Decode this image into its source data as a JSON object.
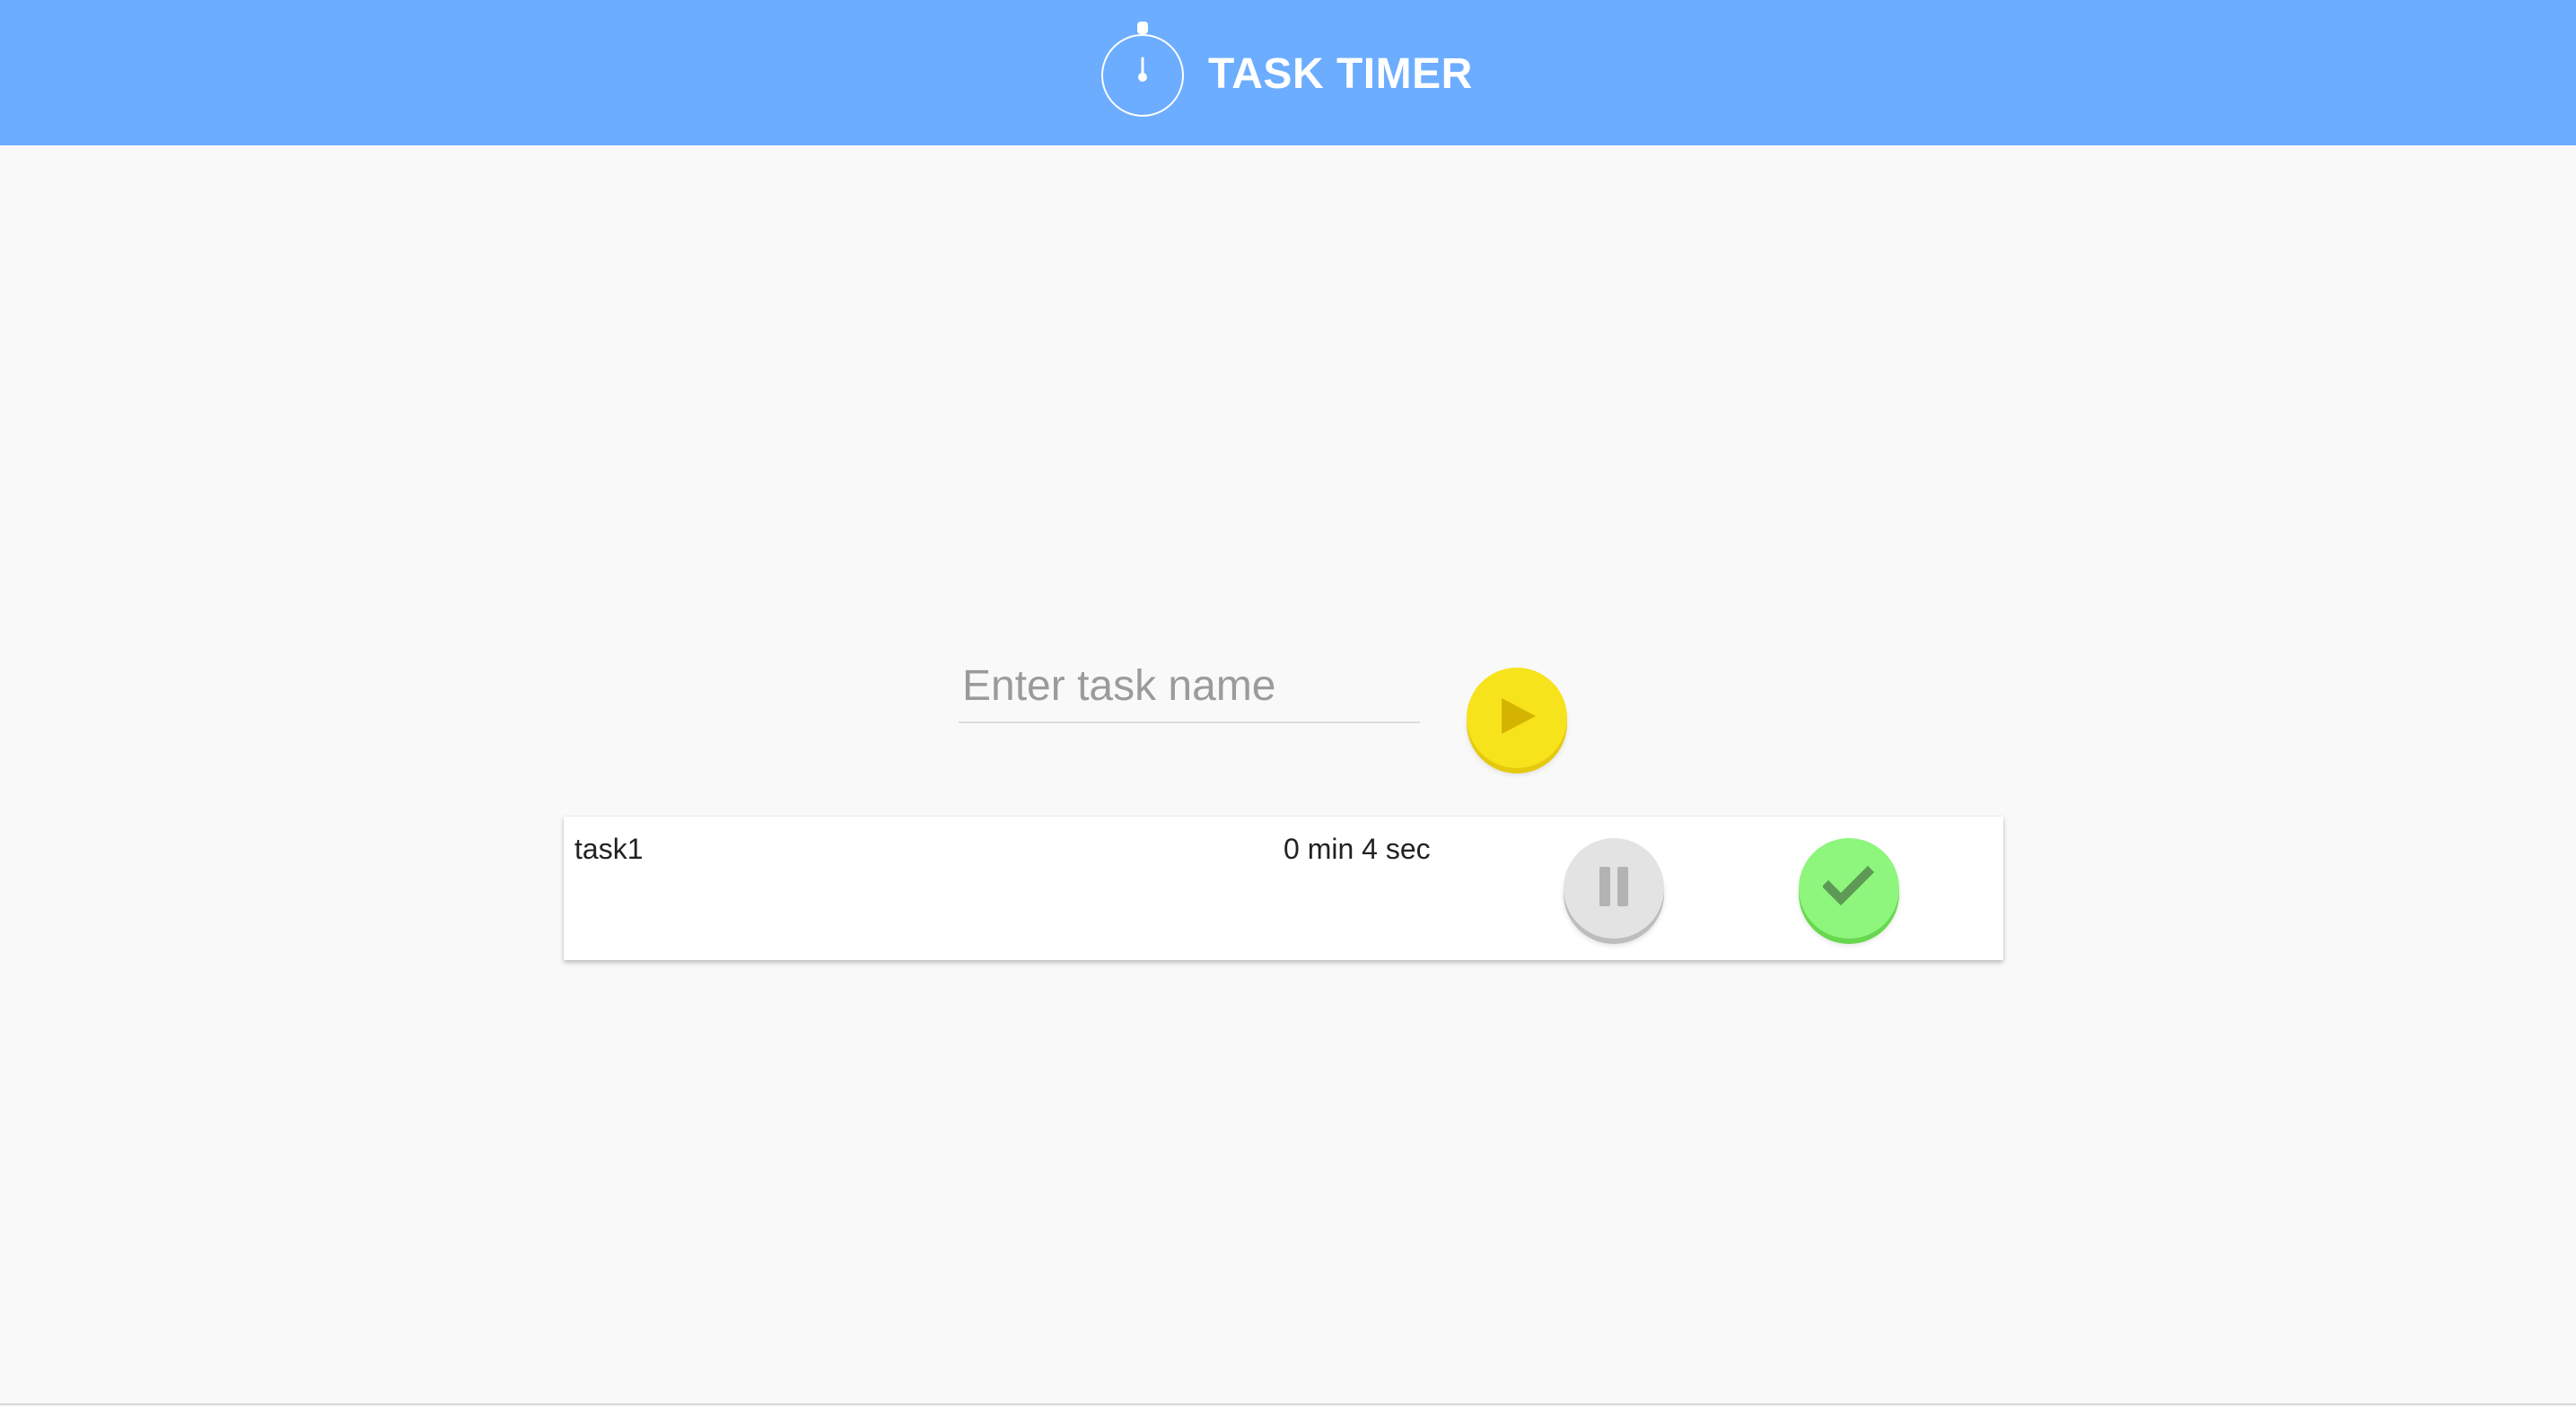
{
  "app": {
    "title": "TASK TIMER",
    "logo_icon": "stopwatch-icon"
  },
  "task_entry": {
    "placeholder": "Enter task name",
    "value": "",
    "start_icon": "play-icon"
  },
  "tasks": [
    {
      "name": "task1",
      "elapsed": "0 min 4 sec",
      "pause_icon": "pause-icon",
      "complete_icon": "checkmark-icon"
    }
  ],
  "colors": {
    "header": "#6cadff",
    "background": "#f9f9f9",
    "start_button": "#f6e31c",
    "pause_button": "#e3e3e3",
    "complete_button": "#8ef57d"
  }
}
